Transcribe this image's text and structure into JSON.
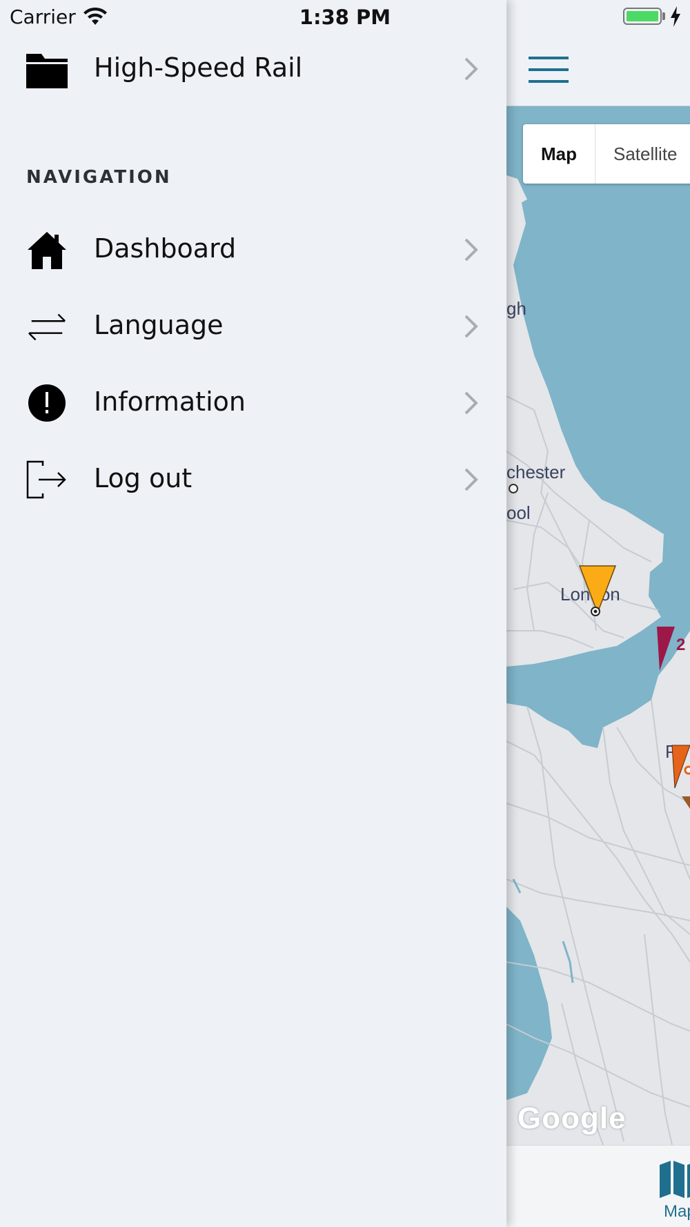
{
  "status_bar": {
    "carrier": "Carrier",
    "time": "1:38 PM",
    "battery_color": "#4cd964"
  },
  "drawer": {
    "project": {
      "label": "High-Speed Rail",
      "icon": "folder-icon"
    },
    "section_title": "NAVIGATION",
    "items": [
      {
        "label": "Dashboard",
        "icon": "home-icon"
      },
      {
        "label": "Language",
        "icon": "swap-arrows-icon"
      },
      {
        "label": "Information",
        "icon": "exclamation-circle-icon"
      },
      {
        "label": "Log out",
        "icon": "logout-icon"
      }
    ]
  },
  "map": {
    "toggle": {
      "map": "Map",
      "satellite": "Satellite",
      "selected": "Map"
    },
    "places": [
      "gh",
      "chester",
      "ool",
      "London",
      "P"
    ],
    "cluster_label": "2",
    "google_logo": "Google",
    "water_color": "#7fb4c9",
    "land_color": "#e4e6e9",
    "marker_colors": {
      "yellow": "#fbab15",
      "crimson": "#9b1848",
      "orange": "#e5631a"
    }
  },
  "tabbar": {
    "map_tab": "Map"
  },
  "accent": "#1f6f8e"
}
